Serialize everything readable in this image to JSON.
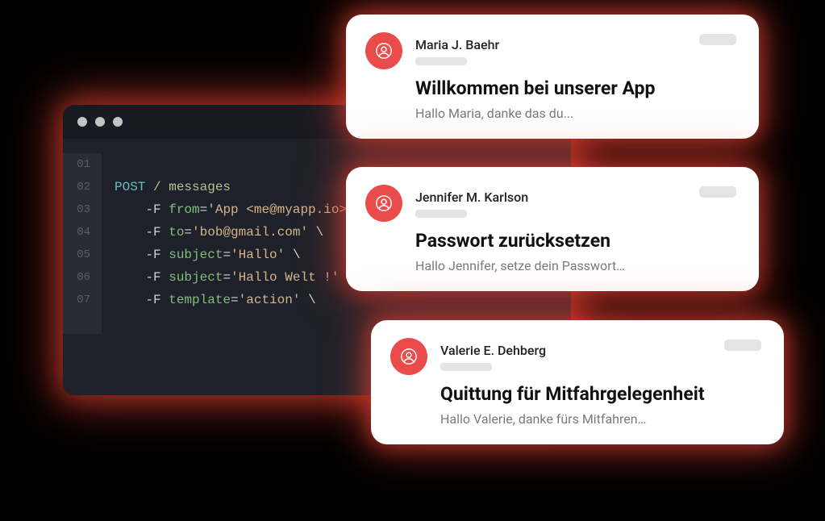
{
  "colors": {
    "accent": "#ea4b4b",
    "code_bg": "#1e2129",
    "titlebar_bg": "#181a21"
  },
  "code": {
    "method": "POST",
    "path": "/ messages",
    "lines": [
      {
        "flag": "-F",
        "key": "from",
        "value": "'App <me@myapp.io>'",
        "cont": "\\"
      },
      {
        "flag": "-F",
        "key": "to",
        "value": "'bob@gmail.com'",
        "cont": "\\"
      },
      {
        "flag": "-F",
        "key": "subject",
        "value": "'Hallo'",
        "cont": "\\"
      },
      {
        "flag": "-F",
        "key": "subject",
        "value": "'Hallo Welt !'",
        "cont": "\\"
      },
      {
        "flag": "-F",
        "key": "template",
        "value": "'action'",
        "cont": "\\"
      }
    ],
    "gutter": [
      "01",
      "02",
      "03",
      "04",
      "05",
      "06",
      "07"
    ]
  },
  "cards": [
    {
      "sender": "Maria J. Baehr",
      "subject": "Willkommen bei unserer App",
      "preview": "Hallo Maria, danke das du..."
    },
    {
      "sender": "Jennifer M. Karlson",
      "subject": "Passwort zurücksetzen",
      "preview": "Hallo Jennifer, setze dein Passwort…"
    },
    {
      "sender": "Valerie E. Dehberg",
      "subject": "Quittung für Mitfahrgelegenheit",
      "preview": "Hallo Valerie, danke fürs Mitfahren…"
    }
  ]
}
